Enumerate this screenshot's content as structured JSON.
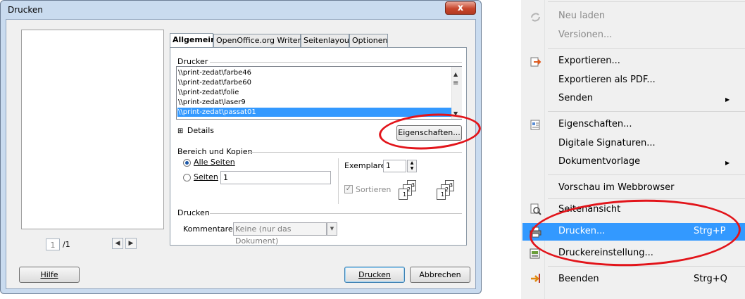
{
  "dialog": {
    "title": "Drucken",
    "close_label": "x",
    "preview": {
      "page_number": "1",
      "page_total": "/1"
    },
    "tabs": [
      "Allgemein",
      "OpenOffice.org Writer",
      "Seitenlayout",
      "Optionen"
    ],
    "printer_section": {
      "legend": "Drucker",
      "printers": [
        "\\\\print-zedat\\farbe46",
        "\\\\print-zedat\\farbe60",
        "\\\\print-zedat\\folie",
        "\\\\print-zedat\\laser9",
        "\\\\print-zedat\\passat01"
      ],
      "selected_index": 4,
      "details_label": "Details",
      "properties_button": "Eigenschaften..."
    },
    "range_section": {
      "legend": "Bereich und Kopien",
      "all_pages_label": "Alle Seiten",
      "pages_label": "Seiten",
      "pages_value": "1",
      "copies_label": "Exemplare",
      "copies_value": "1",
      "collate_label": "Sortieren"
    },
    "print_section": {
      "legend": "Drucken",
      "comments_label": "Kommentare",
      "comments_value": "Keine (nur das Dokument)"
    },
    "buttons": {
      "help": "Hilfe",
      "print": "Drucken",
      "cancel": "Abbrechen"
    }
  },
  "menu": {
    "items": [
      {
        "label": "Neu laden",
        "disabled": true,
        "icon": "reload-icon"
      },
      {
        "label": "Versionen...",
        "disabled": true
      },
      {
        "label": "Exportieren...",
        "icon": "export-icon"
      },
      {
        "label": "Exportieren als PDF..."
      },
      {
        "label": "Senden",
        "submenu": true
      },
      {
        "label": "Eigenschaften...",
        "icon": "properties-icon"
      },
      {
        "label": "Digitale Signaturen..."
      },
      {
        "label": "Dokumentvorlage",
        "submenu": true
      },
      {
        "label": "Vorschau im Webbrowser"
      },
      {
        "label": "Seitenansicht",
        "icon": "page-preview-icon"
      },
      {
        "label": "Drucken...",
        "shortcut": "Strg+P",
        "highlighted": true,
        "icon": "printer-icon"
      },
      {
        "label": "Druckereinstellung...",
        "icon": "printer-settings-icon"
      },
      {
        "label": "Beenden",
        "shortcut": "Strg+Q",
        "icon": "exit-icon"
      }
    ]
  },
  "colors": {
    "highlight": "#3399ff",
    "annotation": "#e2141a"
  }
}
